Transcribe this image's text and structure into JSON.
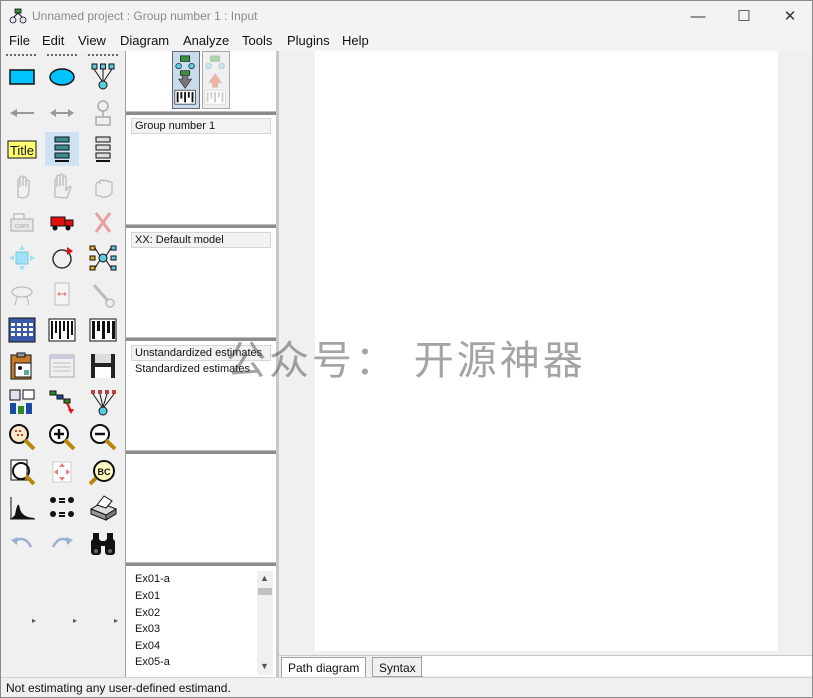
{
  "window": {
    "title": "Unnamed project : Group number 1 : Input",
    "controls": {
      "minimize": "—",
      "maximize": "☐",
      "close": "✕"
    }
  },
  "menu": [
    "File",
    "Edit",
    "View",
    "Diagram",
    "Analyze",
    "Tools",
    "Plugins",
    "Help"
  ],
  "toolbox": {
    "tools": [
      "draw-observed-variable-icon",
      "draw-unobserved-variable-icon",
      "draw-indicator-variable-icon",
      "draw-path-icon",
      "draw-covariance-icon",
      "add-unique-variable-icon",
      "title-icon",
      "list-variables-in-model-icon",
      "list-variables-in-dataset-icon",
      "select-one-object-icon",
      "select-all-objects-icon",
      "deselect-all-objects-icon",
      "duplicate-objects-icon",
      "move-objects-icon",
      "erase-objects-icon",
      "change-shape-icon",
      "rotate-indicators-icon",
      "reflect-indicators-icon",
      "move-parameter-icon",
      "scroll-diagram-icon",
      "touch-up-variable-icon",
      "select-data-files-icon",
      "analysis-properties-icon",
      "calculate-estimates-icon",
      "copy-to-clipboard-icon",
      "view-text-output-icon",
      "save-diagram-icon",
      "object-properties-icon",
      "drag-properties-icon",
      "preserve-symmetries-icon",
      "zoom-selected-area-icon",
      "zoom-in-icon",
      "zoom-out-icon",
      "show-entire-page-icon",
      "resize-diagram-icon",
      "magnifier-icon",
      "bayesian-estimation-icon",
      "multiple-group-analysis-icon",
      "print-diagram-icon",
      "undo-icon",
      "redo-icon",
      "specification-search-icon"
    ],
    "title_tool_label": "Title"
  },
  "io_buttons": {
    "input": "view-input-path-diagram-icon",
    "output": "view-output-path-diagram-icon"
  },
  "panels": {
    "groups": {
      "items": [
        "Group number 1"
      ]
    },
    "models": {
      "items": [
        "XX: Default model"
      ]
    },
    "estimates": {
      "items": [
        "Unstandardized estimates",
        "Standardized estimates"
      ]
    },
    "files": {
      "items": [
        "Ex01-a",
        "Ex01",
        "Ex02",
        "Ex03",
        "Ex04",
        "Ex05-a"
      ]
    }
  },
  "tabs": [
    "Path diagram",
    "Syntax"
  ],
  "watermark": "公众号： 开源神器",
  "status": "Not estimating any user-defined estimand."
}
